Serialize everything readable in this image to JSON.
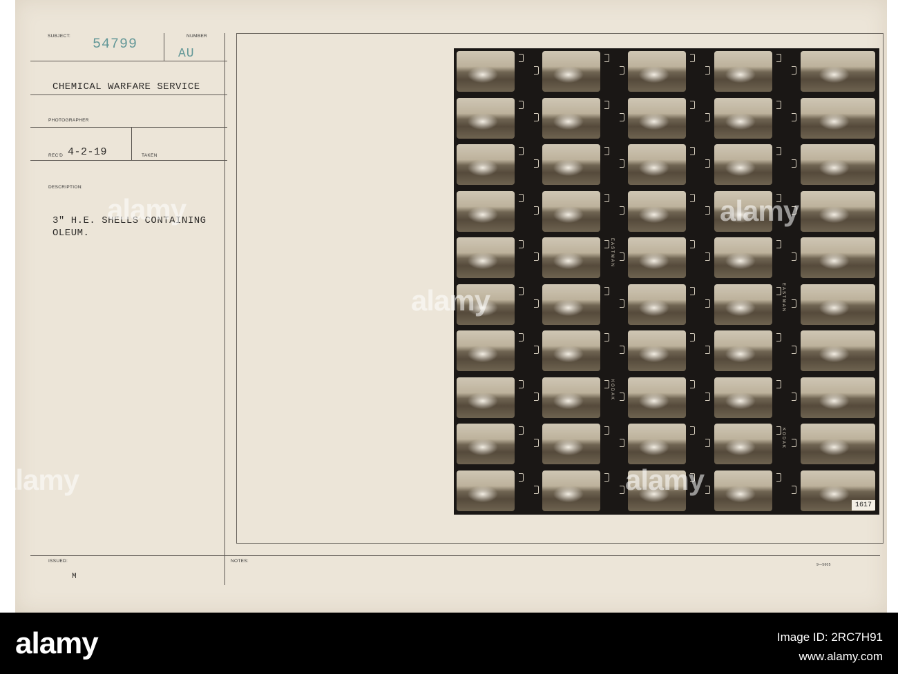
{
  "card": {
    "subject_label": "SUBJECT:",
    "subject_value": "54799",
    "number_label": "NUMBER",
    "number_value": "AU",
    "org_line": "CHEMICAL WARFARE SERVICE",
    "photographer_label": "PHOTOGRAPHER",
    "recd_label": "REC'D",
    "recd_value": "4-2-19",
    "taken_label": "TAKEN",
    "description_label": "DESCRIPTION:",
    "description_line1": "3\" H.E. SHELLS CONTAINING",
    "description_line2": "OLEUM.",
    "issued_label": "ISSUED:",
    "issued_mark": "M",
    "notes_label": "NOTES:",
    "form_number": "9—5605"
  },
  "contact_sheet": {
    "sheet_number": "1617",
    "edge_text_1": "EASTMAN",
    "edge_text_2": "KODAK",
    "columns": 5,
    "rows": 10
  },
  "watermark": {
    "brand": "alamy"
  },
  "footer": {
    "brand": "alamy",
    "image_id_label": "Image ID: 2RC7H91",
    "site": "www.alamy.com"
  }
}
